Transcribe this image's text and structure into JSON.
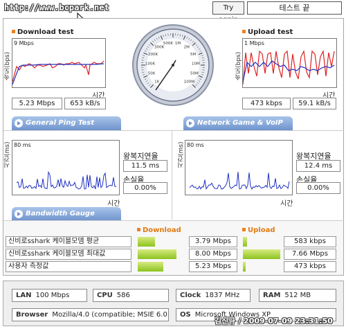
{
  "header": {
    "url": "http://www.bcpark.net",
    "try_again_label": "Try again",
    "test_end_label": "테스트 끝"
  },
  "download": {
    "title": "Download test",
    "ylabel": "속도(bps)",
    "scale": "9 Mbps",
    "xlabel": "시간",
    "speed_mbps": "5.23 Mbps",
    "speed_kbs": "653 kB/s"
  },
  "upload": {
    "title": "Upload test",
    "ylabel": "속도(bps)",
    "scale": "1 Mbps",
    "xlabel": "시간",
    "speed_kbps": "473 kbps",
    "speed_kbs": "59.1 kB/s"
  },
  "gauge": {
    "labels": [
      "1K",
      "50K",
      "100K",
      "200K",
      "300K",
      "500K",
      "1M",
      "2M",
      "5M",
      "10M",
      "50M",
      "100M"
    ]
  },
  "ping": {
    "tab_label": "General Ping Test",
    "ylabel": "시간(ms)",
    "scale": "80 ms",
    "xlabel": "시간",
    "rtt_label": "왕복지연율",
    "rtt_value": "11.5 ms",
    "loss_label": "손실율",
    "loss_value": "0.00%"
  },
  "game": {
    "tab_label": "Network Game & VoIP Test",
    "ylabel": "시간(ms)",
    "scale": "80 ms",
    "xlabel": "시간",
    "rtt_label": "왕복지연율",
    "rtt_value": "12.4 ms",
    "loss_label": "손실율",
    "loss_value": "0.00%"
  },
  "bandwidth": {
    "tab_label": "Bandwidth Gauge",
    "download_head": "Download",
    "upload_head": "Upload",
    "rows": [
      {
        "label": "신비로sshark 케이블모뎀 평균",
        "download": "3.79 Mbps",
        "upload": "583 kbps",
        "dl_fill": 0.35,
        "ul_fill": 0.1
      },
      {
        "label": "신비로sshark 케이블모뎀 최대값",
        "download": "8.00 Mbps",
        "upload": "7.66 Mbps",
        "dl_fill": 0.8,
        "ul_fill": 0.97
      },
      {
        "label": "사용자 측정값",
        "download": "5.23 Mbps",
        "upload": "473 kbps",
        "dl_fill": 0.53,
        "ul_fill": 0.08
      }
    ]
  },
  "system": {
    "lan_key": "LAN",
    "lan_val": "100 Mbps",
    "cpu_key": "CPU",
    "cpu_val": "586",
    "clock_key": "Clock",
    "clock_val": "1837 MHz",
    "ram_key": "RAM",
    "ram_val": "512 MB",
    "browser_key": "Browser",
    "browser_val": "Mozilla/4.0 (compatible; MSIE 6.0",
    "os_key": "OS",
    "os_val": "Microsoft Windows XP"
  },
  "watermark": "김신규 / 2009-07-09 23:31:50",
  "colors": {
    "accent_orange": "#f08020",
    "tab_blue": "#6f93cc",
    "bar_green": "#8cc31e",
    "series_red": "#e02020",
    "series_blue": "#2030c0"
  }
}
